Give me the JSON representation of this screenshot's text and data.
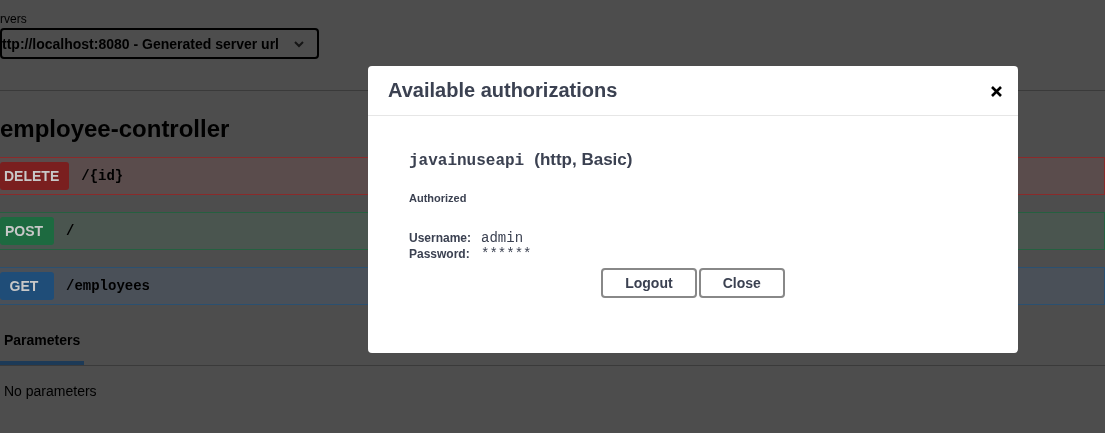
{
  "servers": {
    "label": "rvers",
    "selected_url": "ttp://localhost:8080 - Generated server url"
  },
  "controller": {
    "title": "employee-controller"
  },
  "operations": [
    {
      "kind": "delete",
      "method": "DELETE",
      "path": "/{id}"
    },
    {
      "kind": "post",
      "method": "POST",
      "path": "/"
    },
    {
      "kind": "get",
      "method": "GET",
      "path": "/employees"
    }
  ],
  "parameters": {
    "tabs": [
      {
        "label": "Parameters",
        "selected": true
      }
    ],
    "message": "No parameters"
  },
  "dialog": {
    "title": "Available authorizations",
    "scheme": {
      "name": "javainuseapi",
      "type": "(http, Basic)",
      "status": "Authorized",
      "fields": [
        {
          "label": "Username:",
          "value": "admin"
        },
        {
          "label": "Password:",
          "value": "******"
        }
      ]
    },
    "buttons": [
      "Logout",
      "Close"
    ]
  }
}
